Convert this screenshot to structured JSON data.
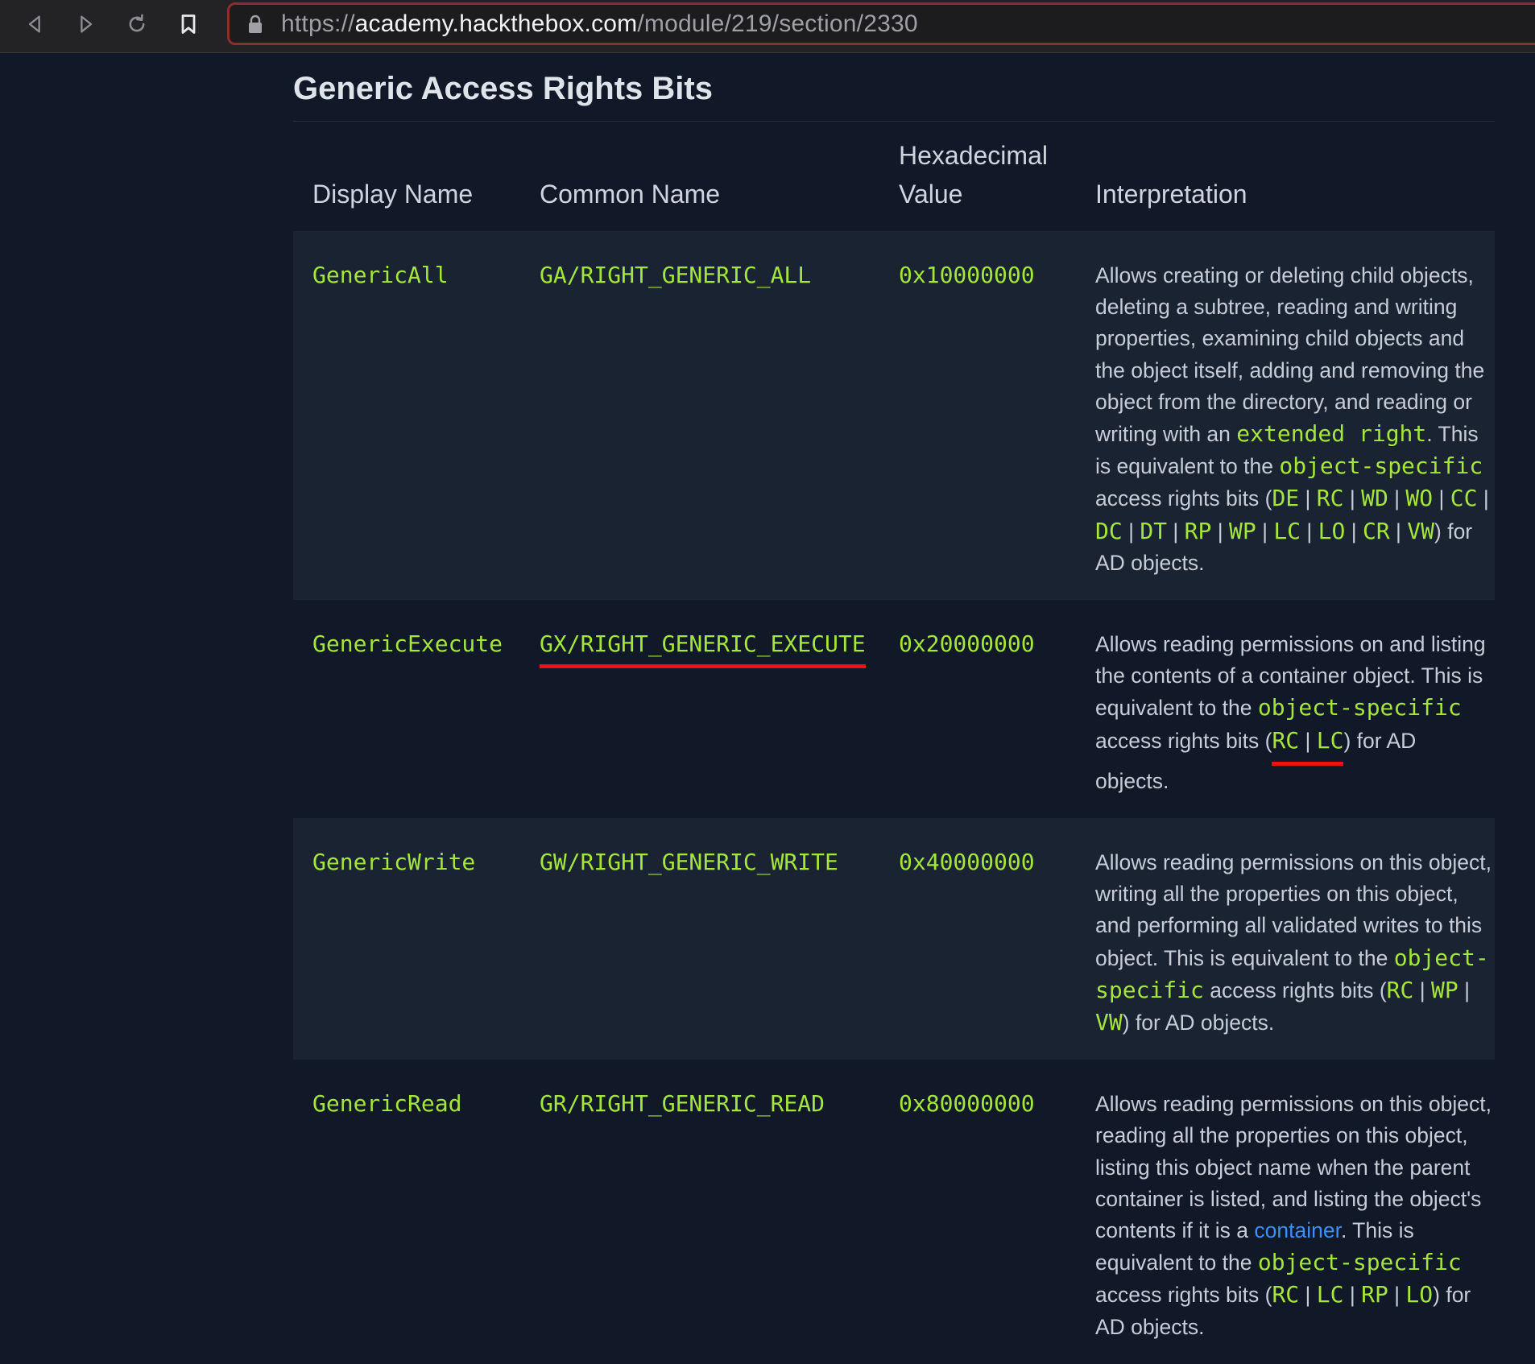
{
  "browser": {
    "url_scheme": "https://",
    "url_host": "academy.hackthebox.com",
    "url_path": "/module/219/section/2330"
  },
  "page": {
    "title": "Generic Access Rights Bits"
  },
  "table": {
    "headers": {
      "display_name": "Display Name",
      "common_name": "Common Name",
      "hex_line1": "Hexadecimal",
      "hex_line2": "Value",
      "interpretation": "Interpretation"
    },
    "rows": [
      {
        "display_name": "GenericAll",
        "common_name": "GA/RIGHT_GENERIC_ALL",
        "hex": "0x10000000",
        "interp": {
          "t1": "Allows creating or deleting child objects, deleting a subtree, reading and writing properties, examining child objects and the object itself, adding and removing the object from the directory, and reading or writing with an ",
          "c1": "extended right",
          "t2": ". This is equivalent to the ",
          "c2": "object-specific",
          "t3": " access rights bits (",
          "bits": [
            "DE",
            "RC",
            "WD",
            "WO",
            "CC",
            "DC",
            "DT",
            "RP",
            "WP",
            "LC",
            "LO",
            "CR",
            "VW"
          ],
          "sep": " | ",
          "t4": ") for AD objects."
        }
      },
      {
        "display_name": "GenericExecute",
        "common_name": "GX/RIGHT_GENERIC_EXECUTE",
        "hex": "0x20000000",
        "interp": {
          "t1": "Allows reading permissions on and listing the contents of a container object. This is equivalent to the ",
          "c1": "object-specific",
          "t2": " access rights bits (",
          "bits": [
            "RC",
            "LC"
          ],
          "sep": " | ",
          "t3": ") for AD objects."
        }
      },
      {
        "display_name": "GenericWrite",
        "common_name": "GW/RIGHT_GENERIC_WRITE",
        "hex": "0x40000000",
        "interp": {
          "t1": "Allows reading permissions on this object, writing all the properties on this object, and performing all validated writes to this object. This is equivalent to the ",
          "c1": "object-specific",
          "t2": " access rights bits (",
          "bits": [
            "RC",
            "WP",
            "VW"
          ],
          "sep": " | ",
          "t3": ") for AD objects."
        }
      },
      {
        "display_name": "GenericRead",
        "common_name": "GR/RIGHT_GENERIC_READ",
        "hex": "0x80000000",
        "interp": {
          "t1": "Allows reading permissions on this object, reading all the properties on this object, listing this object name when the parent container is listed, and listing the object's contents if it is a ",
          "link": "container",
          "t2": ". This is equivalent to the ",
          "c1": "object-specific",
          "t3": " access rights bits (",
          "bits": [
            "RC",
            "LC",
            "RP",
            "LO"
          ],
          "sep": " | ",
          "t4": ") for AD objects."
        }
      }
    ]
  }
}
